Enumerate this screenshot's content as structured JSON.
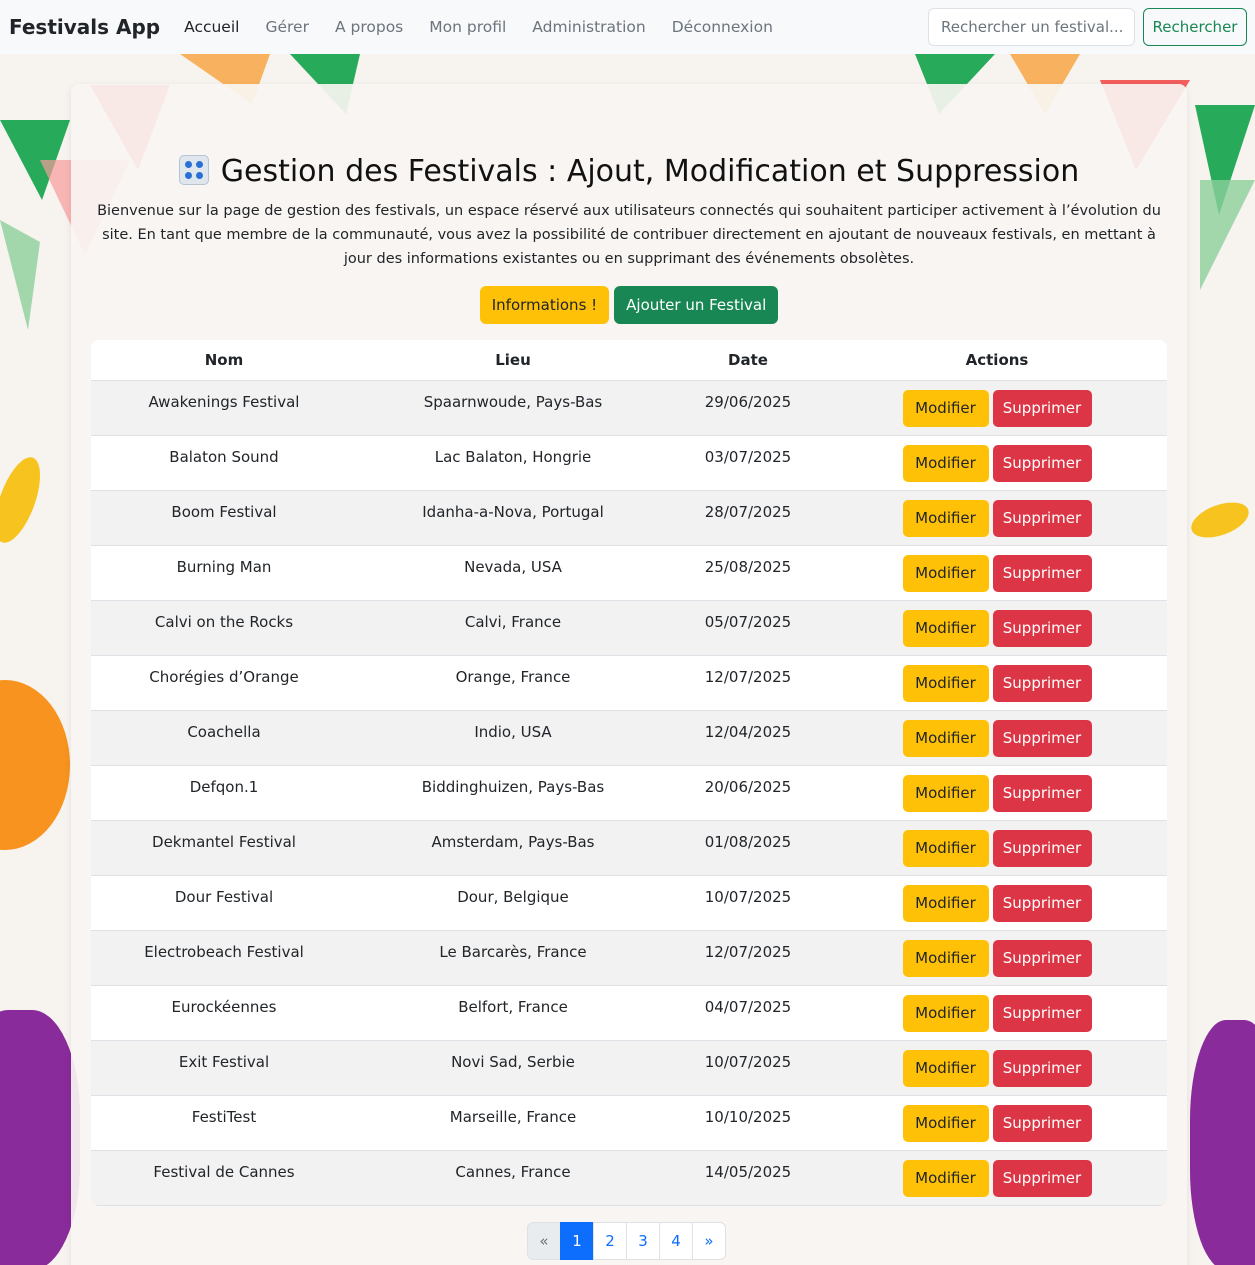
{
  "navbar": {
    "brand": "Festivals App",
    "links": [
      "Accueil",
      "Gérer",
      "A propos",
      "Mon profil",
      "Administration",
      "Déconnexion"
    ],
    "search_placeholder": "Rechercher un festival...",
    "search_button": "Rechercher"
  },
  "page": {
    "title": "Gestion des Festivals : Ajout, Modification et Suppression",
    "intro": "Bienvenue sur la page de gestion des festivals, un espace réservé aux utilisateurs connectés qui souhaitent participer activement à l’évolution du site. En tant que membre de la communauté, vous avez la possibilité de contribuer directement en ajoutant de nouveaux festivals, en mettant à jour des informations existantes ou en supprimant des événements obsolètes.",
    "info_button": "Informations !",
    "add_button": "Ajouter un Festival"
  },
  "table": {
    "headers": [
      "Nom",
      "Lieu",
      "Date",
      "Actions"
    ],
    "edit_label": "Modifier",
    "delete_label": "Supprimer",
    "rows": [
      {
        "nom": "Awakenings Festival",
        "lieu": "Spaarnwoude, Pays-Bas",
        "date": "29/06/2025"
      },
      {
        "nom": "Balaton Sound",
        "lieu": "Lac Balaton, Hongrie",
        "date": "03/07/2025"
      },
      {
        "nom": "Boom Festival",
        "lieu": "Idanha-a-Nova, Portugal",
        "date": "28/07/2025"
      },
      {
        "nom": "Burning Man",
        "lieu": "Nevada, USA",
        "date": "25/08/2025"
      },
      {
        "nom": "Calvi on the Rocks",
        "lieu": "Calvi, France",
        "date": "05/07/2025"
      },
      {
        "nom": "Chorégies d’Orange",
        "lieu": "Orange, France",
        "date": "12/07/2025"
      },
      {
        "nom": "Coachella",
        "lieu": "Indio, USA",
        "date": "12/04/2025"
      },
      {
        "nom": "Defqon.1",
        "lieu": "Biddinghuizen, Pays-Bas",
        "date": "20/06/2025"
      },
      {
        "nom": "Dekmantel Festival",
        "lieu": "Amsterdam, Pays-Bas",
        "date": "01/08/2025"
      },
      {
        "nom": "Dour Festival",
        "lieu": "Dour, Belgique",
        "date": "10/07/2025"
      },
      {
        "nom": "Electrobeach Festival",
        "lieu": "Le Barcarès, France",
        "date": "12/07/2025"
      },
      {
        "nom": "Eurockéennes",
        "lieu": "Belfort, France",
        "date": "04/07/2025"
      },
      {
        "nom": "Exit Festival",
        "lieu": "Novi Sad, Serbie",
        "date": "10/07/2025"
      },
      {
        "nom": "FestiTest",
        "lieu": "Marseille, France",
        "date": "10/10/2025"
      },
      {
        "nom": "Festival de Cannes",
        "lieu": "Cannes, France",
        "date": "14/05/2025"
      }
    ]
  },
  "pagination": {
    "prev": "«",
    "pages": [
      "1",
      "2",
      "3",
      "4"
    ],
    "current": "1",
    "next": "»"
  },
  "colors": {
    "warning": "#ffc107",
    "danger": "#dc3545",
    "success": "#198754",
    "primary": "#0d6efd"
  }
}
